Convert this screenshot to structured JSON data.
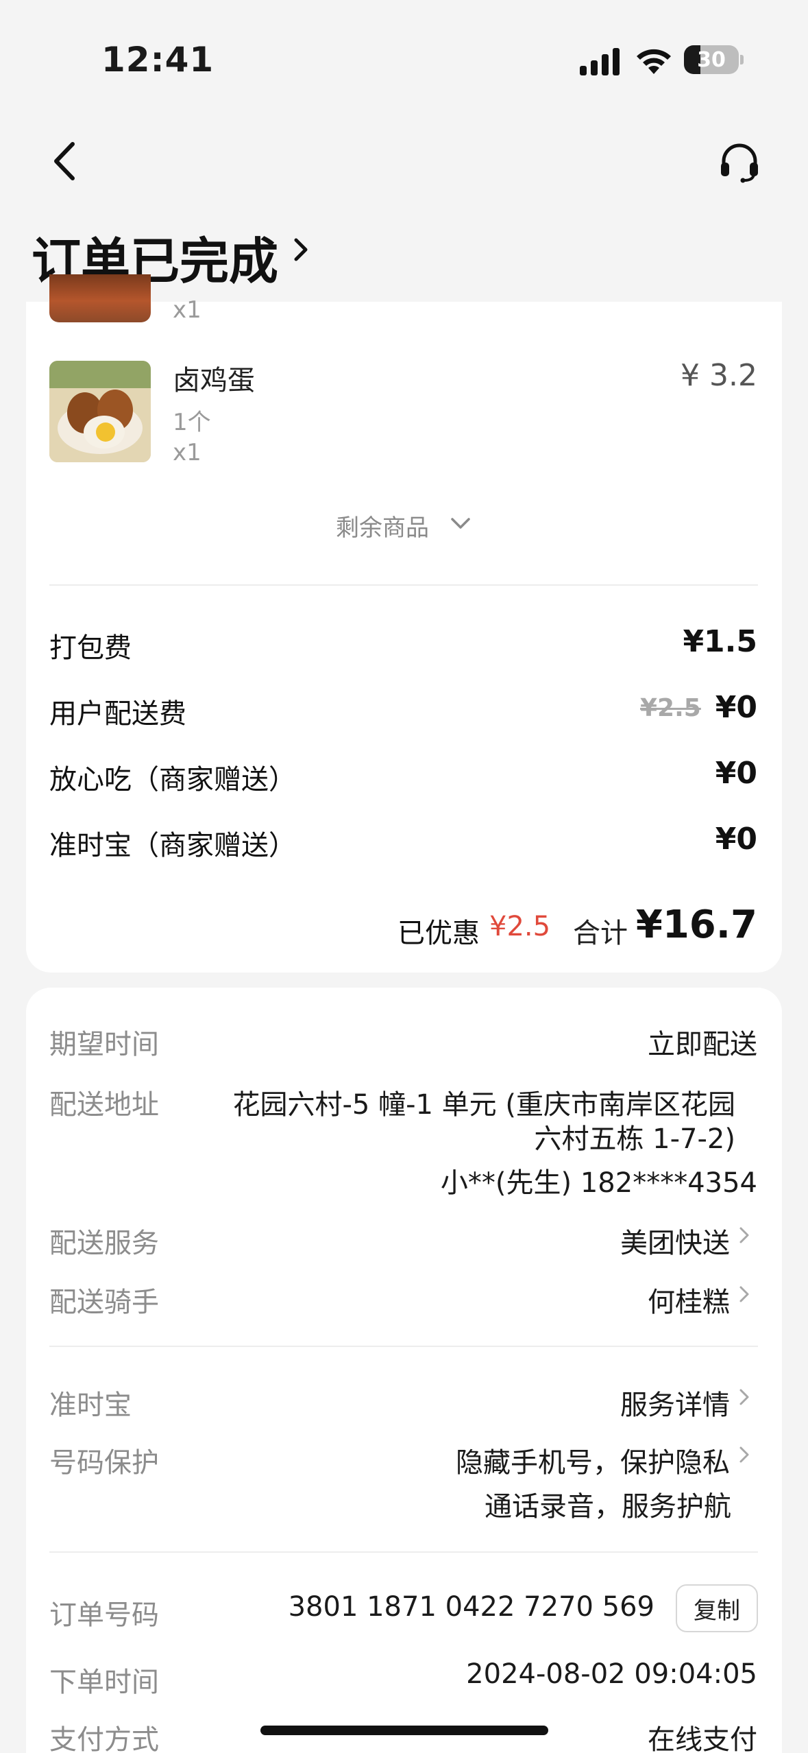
{
  "status_bar": {
    "time": "12:41",
    "battery": "30",
    "battery_level": 0.3
  },
  "nav": {
    "back_icon": "chevron-left-icon",
    "service_icon": "headset-icon"
  },
  "header": {
    "title": "订单已完成"
  },
  "items": {
    "previous": {
      "qty": "x1"
    },
    "egg": {
      "name": "卤鸡蛋",
      "spec": "1个",
      "qty": "x1",
      "price": "¥ 3.2"
    },
    "more_label": "剩余商品"
  },
  "fees": [
    {
      "label": "打包费",
      "value": "¥1.5"
    },
    {
      "label": "用户配送费",
      "original": "¥2.5",
      "value": "¥0"
    },
    {
      "label": "放心吃（商家赠送）",
      "value": "¥0"
    },
    {
      "label": "准时宝（商家赠送）",
      "value": "¥0"
    }
  ],
  "summary": {
    "discount_label": "已优惠",
    "discount_value": "¥2.5",
    "total_label": "合计",
    "total_value": "¥16.7"
  },
  "delivery": {
    "expected_label": "期望时间",
    "expected_value": "立即配送",
    "address_label": "配送地址",
    "address_line1": "花园六村-5 幢-1 单元 (重庆市南岸区花园",
    "address_line2": "六村五栋 1-7-2)",
    "contact": "小**(先生) 182****4354",
    "service_label": "配送服务",
    "service_value": "美团快送",
    "rider_label": "配送骑手",
    "rider_value": "何桂糕"
  },
  "protection": {
    "ontime_label": "准时宝",
    "ontime_value": "服务详情",
    "phone_label": "号码保护",
    "phone_line1": "隐藏手机号，保护隐私",
    "phone_line2": "通话录音，服务护航"
  },
  "order": {
    "number_label": "订单号码",
    "number_value": "3801 1871 0422 7270 569",
    "copy_label": "复制",
    "time_label": "下单时间",
    "time_value": "2024-08-02 09:04:05",
    "pay_label": "支付方式",
    "pay_value": "在线支付"
  },
  "colors": {
    "discount_red": "#e0493b",
    "page_bg": "#f4f4f4"
  }
}
